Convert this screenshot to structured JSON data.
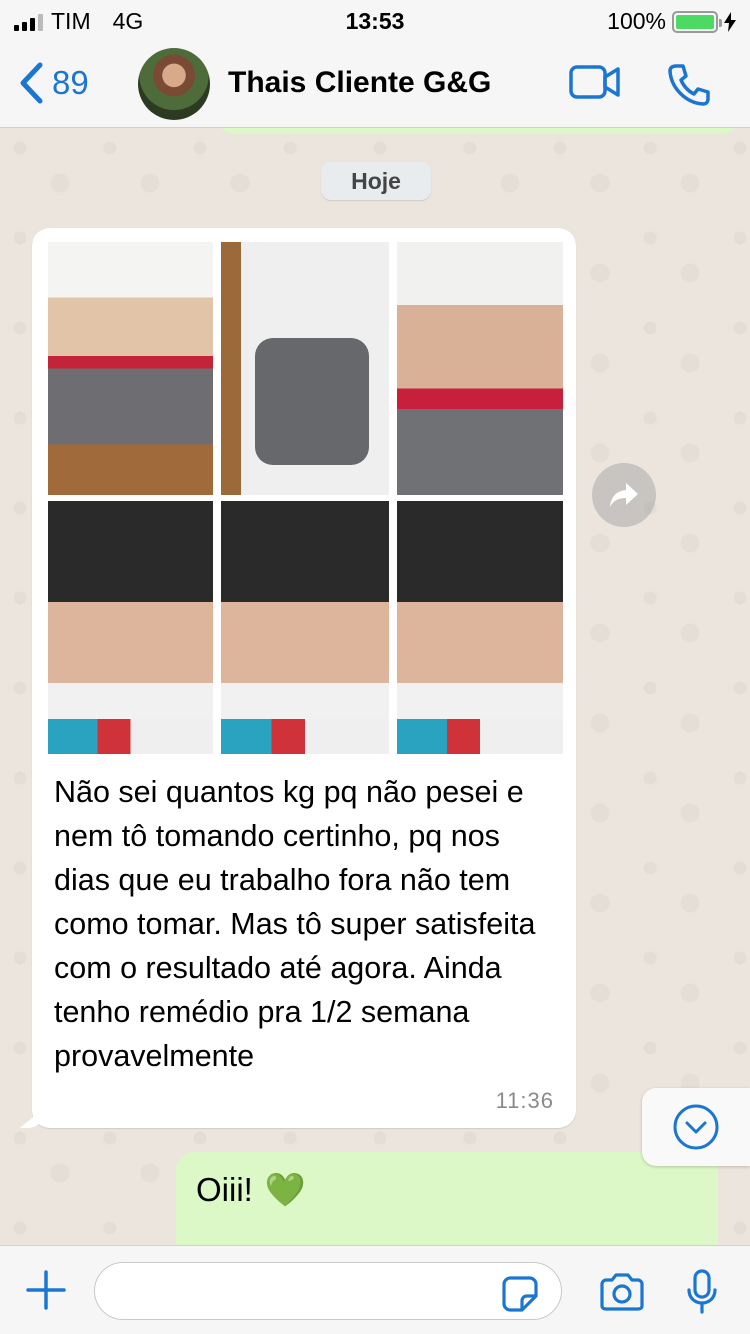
{
  "status_bar": {
    "carrier": "TIM",
    "network": "4G",
    "time": "13:53",
    "battery": "100%"
  },
  "header": {
    "back_count": "89",
    "contact_name": "Thais Cliente G&G"
  },
  "chat": {
    "date_label": "Hoje",
    "incoming": {
      "text": "Não sei quantos kg pq não pesei e nem tô tomando certinho, pq nos dias que eu trabalho fora não tem como tomar. Mas tô super satisfeita com o resultado até agora. Ainda tenho remédio pra 1/2 semana provavelmente",
      "time": "11:36"
    },
    "outgoing": {
      "text": "Oiii!",
      "emoji": "💚"
    }
  },
  "input": {
    "placeholder": ""
  },
  "colors": {
    "accent": "#1b76d2",
    "outgoing_bubble": "#dcf8c6",
    "chat_bg": "#ece5dd"
  }
}
